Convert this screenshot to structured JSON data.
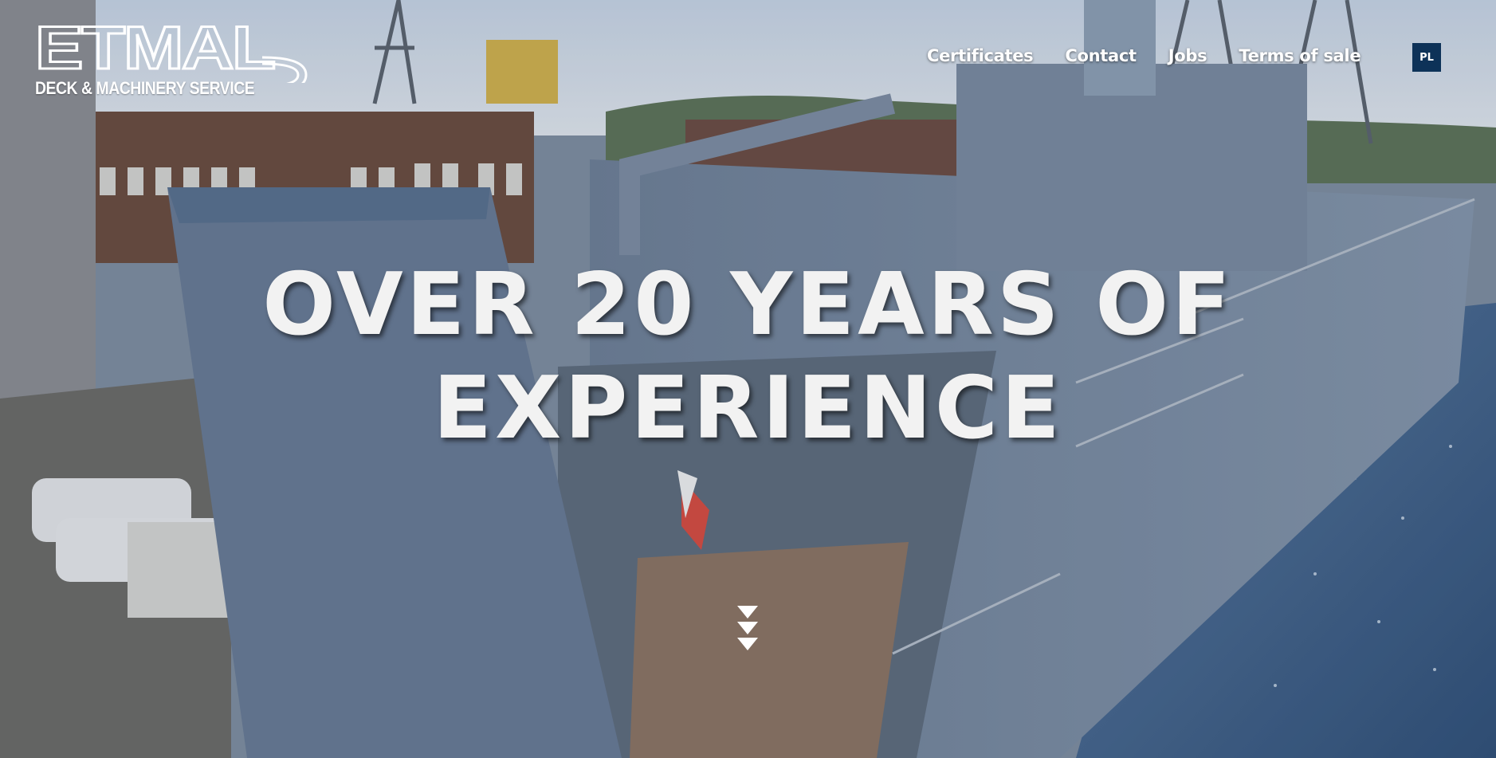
{
  "brand": {
    "logo_text": "ETMAL",
    "tagline": "DECK & MACHINERY SERVICE"
  },
  "nav": {
    "items": [
      {
        "label": "Certificates"
      },
      {
        "label": "Contact"
      },
      {
        "label": "Jobs"
      },
      {
        "label": "Terms of sale"
      }
    ],
    "language_button": "PL"
  },
  "hero": {
    "headline_line1": "OVER 20 YEARS OF",
    "headline_line2": "EXPERIENCE",
    "scroll_icon": "triple-chevron-down-icon",
    "background": "shipyard-vessel-photo"
  },
  "colors": {
    "language_button_bg": "#0d3258",
    "text": "#ffffff",
    "water": "#3d5f86",
    "ship_hull": "#7d8ea3"
  }
}
